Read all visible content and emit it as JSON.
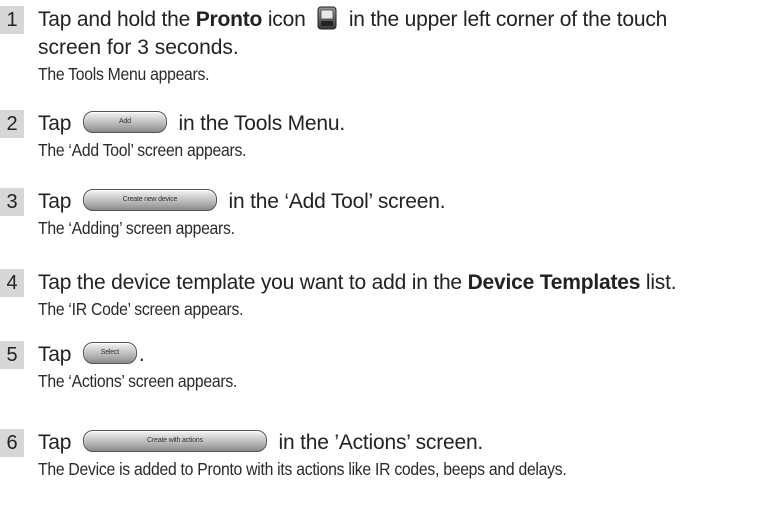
{
  "steps": [
    {
      "number": "1",
      "before": "Tap and hold the ",
      "bold": "Pronto",
      "after_icon_pre": " icon ",
      "after": " in the upper left corner of the touch",
      "continuation": "screen for 3 seconds.",
      "result": "The Tools Menu appears.",
      "icon": "pronto-remote-icon"
    },
    {
      "number": "2",
      "before": "Tap ",
      "button_label": "Add",
      "after": " in the Tools Menu.",
      "result": "The ‘Add Tool’ screen appears."
    },
    {
      "number": "3",
      "before": "Tap ",
      "button_label": "Create new device",
      "after": " in the ‘Add Tool’ screen.",
      "result": "The ‘Adding’ screen appears."
    },
    {
      "number": "4",
      "before": "Tap the device template you want to add in the ",
      "bold": "Device Templates",
      "after": " list.",
      "result": "The ‘IR Code’ screen appears."
    },
    {
      "number": "5",
      "before": "Tap ",
      "button_label": "Select",
      "after": ".",
      "result": "The ‘Actions’ screen appears."
    },
    {
      "number": "6",
      "before": "Tap ",
      "button_label": "Create with actions",
      "after": " in the ’Actions’ screen.",
      "result": "The Device is added to Pronto with its actions like IR codes, beeps and delays."
    }
  ]
}
